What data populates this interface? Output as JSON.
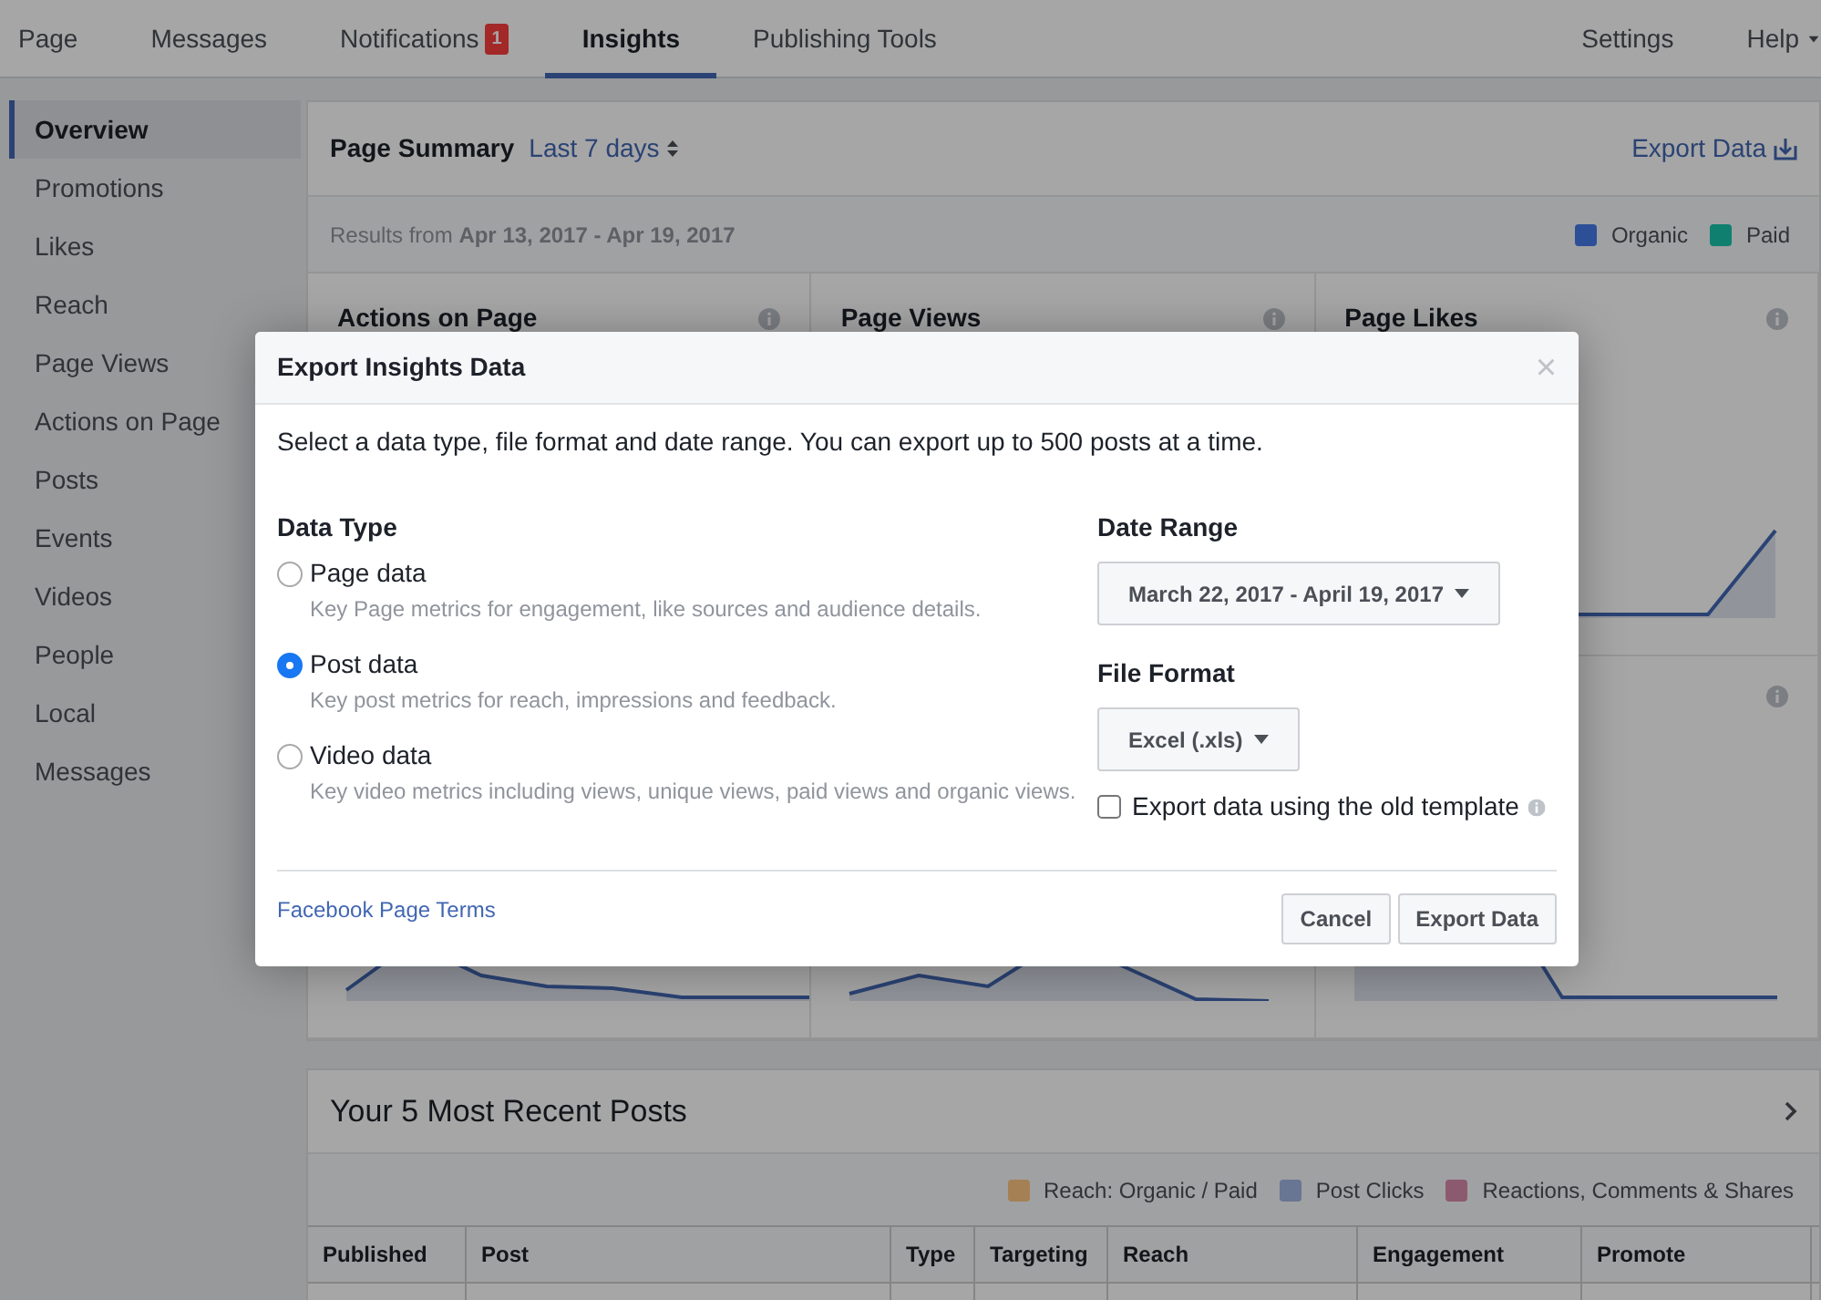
{
  "top_nav": {
    "tabs": [
      {
        "label": "Page",
        "selected": false
      },
      {
        "label": "Messages",
        "selected": false
      },
      {
        "label": "Notifications",
        "selected": false,
        "badge": "1"
      },
      {
        "label": "Insights",
        "selected": true
      },
      {
        "label": "Publishing Tools",
        "selected": false
      }
    ],
    "right_links": [
      {
        "label": "Settings",
        "kind": "link"
      },
      {
        "label": "Help",
        "kind": "menu"
      }
    ]
  },
  "sidebar": {
    "items": [
      {
        "label": "Overview",
        "selected": true
      },
      {
        "label": "Promotions",
        "selected": false
      },
      {
        "label": "Likes",
        "selected": false
      },
      {
        "label": "Reach",
        "selected": false
      },
      {
        "label": "Page Views",
        "selected": false
      },
      {
        "label": "Actions on Page",
        "selected": false
      },
      {
        "label": "Posts",
        "selected": false
      },
      {
        "label": "Events",
        "selected": false
      },
      {
        "label": "Videos",
        "selected": false
      },
      {
        "label": "People",
        "selected": false
      },
      {
        "label": "Local",
        "selected": false
      },
      {
        "label": "Messages",
        "selected": false
      }
    ]
  },
  "page_summary": {
    "title": "Page Summary",
    "period": "Last 7 days",
    "export_link": "Export Data",
    "results": "Results from **Apr 13, 2017 - Apr 19, 2017**",
    "legend": [
      {
        "label": "Organic",
        "color": "#2d4f98"
      },
      {
        "label": "Paid",
        "color": "#0f8070"
      }
    ],
    "metric_cards": [
      {
        "title": "Actions on Page"
      },
      {
        "title": "Page Views"
      },
      {
        "title": "Page Likes"
      }
    ]
  },
  "recent_posts": {
    "title": "Your 5 Most Recent Posts",
    "legend": [
      {
        "label": "Reach: Organic / Paid",
        "color": "#a58055"
      },
      {
        "label": "Post Clicks",
        "color": "#687593"
      },
      {
        "label": "Reactions, Comments & Shares",
        "color": "#8c5a6e"
      }
    ],
    "columns": [
      "Published",
      "Post",
      "Type",
      "Targeting",
      "Reach",
      "Engagement",
      "Promote"
    ]
  },
  "modal": {
    "title": "Export Insights Data",
    "close": "×",
    "intro": "Select a data type, file format and date range. You can export up to 500 posts at a time.",
    "data_type_label": "Data Type",
    "options": [
      {
        "label": "Page data",
        "description": "Key Page metrics for engagement, like sources and audience details.",
        "selected": false
      },
      {
        "label": "Post data",
        "description": "Key post metrics for reach, impressions and feedback.",
        "selected": true
      },
      {
        "label": "Video data",
        "description": "Key video metrics including views, unique views, paid views and organic views.",
        "selected": false
      }
    ],
    "date_range_label": "Date Range",
    "date_range": "March 22, 2017 - April 19, 2017",
    "file_format_label": "File Format",
    "file_format": "Excel (.xls)",
    "old_template": {
      "label": "Export data using the old template",
      "checked": false
    },
    "terms_link": "Facebook Page Terms",
    "buttons": [
      {
        "label": "Cancel",
        "kind": "secondary"
      },
      {
        "label": "Export Data",
        "kind": "secondary"
      }
    ]
  }
}
